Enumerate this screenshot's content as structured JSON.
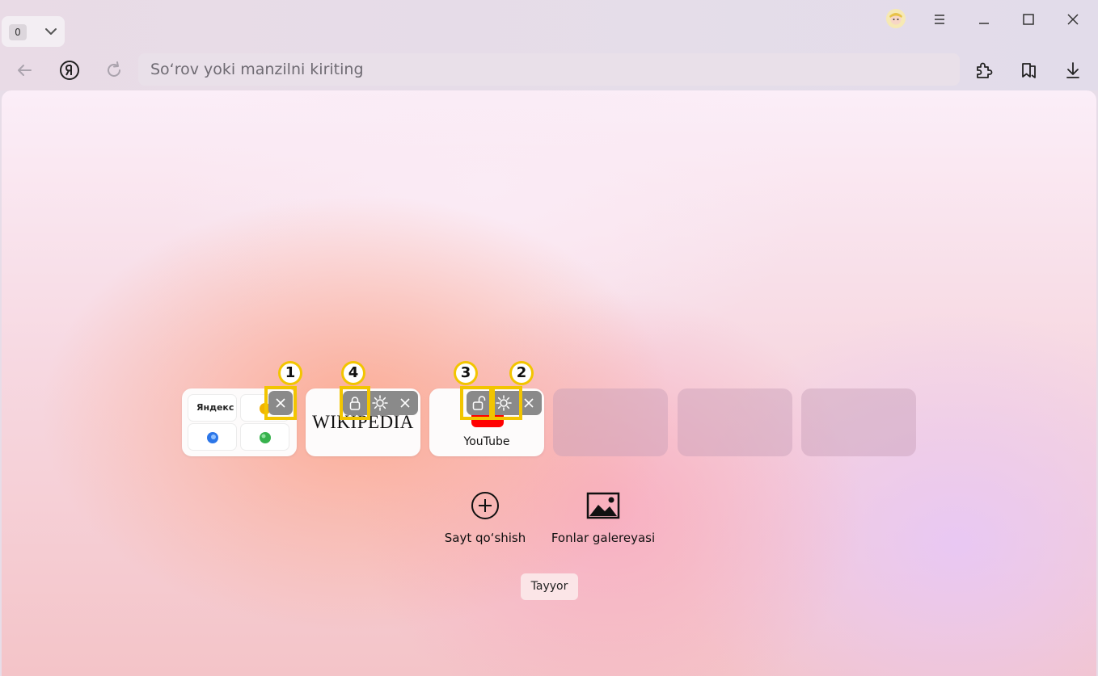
{
  "tabs": {
    "count": "0"
  },
  "address_bar": {
    "placeholder": "So‘rov yoki manzilni kiriting"
  },
  "tiles": [
    {
      "kind": "folder",
      "mini_sites": [
        "Яндекс",
        "",
        "",
        ""
      ]
    },
    {
      "kind": "site",
      "label": "Wikipedia",
      "logo_text": "WIKIPEDIA"
    },
    {
      "kind": "site",
      "label": "YouTube"
    },
    {
      "kind": "empty"
    },
    {
      "kind": "empty"
    },
    {
      "kind": "empty"
    }
  ],
  "callouts": [
    "1",
    "4",
    "3",
    "2"
  ],
  "actions": {
    "add_site": "Sayt qo‘shish",
    "backgrounds": "Fonlar galereyasi"
  },
  "done_label": "Tayyor",
  "colors": {
    "highlight": "#f2c500",
    "control_bg": "#8a8a8a",
    "youtube_red": "#ff0000",
    "yandex_red": "#fc3f1d"
  }
}
